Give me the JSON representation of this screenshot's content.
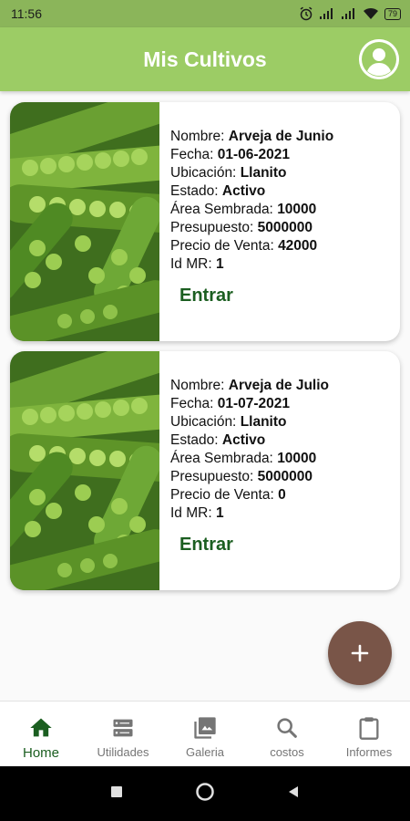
{
  "status": {
    "time": "11:56",
    "battery": "79"
  },
  "app": {
    "title": "Mis Cultivos"
  },
  "cards": [
    {
      "nombre_label": "Nombre: ",
      "nombre": "Arveja de Junio",
      "fecha_label": "Fecha: ",
      "fecha": "01-06-2021",
      "ubicacion_label": "Ubicación: ",
      "ubicacion": "Llanito",
      "estado_label": "Estado: ",
      "estado": "Activo",
      "area_label": "Área Sembrada: ",
      "area": "10000",
      "presupuesto_label": "Presupuesto: ",
      "presupuesto": "5000000",
      "precio_label": "Precio de Venta: ",
      "precio": "42000",
      "id_label": "Id MR: ",
      "id": "1",
      "button": "Entrar"
    },
    {
      "nombre_label": "Nombre: ",
      "nombre": "Arveja de Julio",
      "fecha_label": "Fecha: ",
      "fecha": "01-07-2021",
      "ubicacion_label": "Ubicación: ",
      "ubicacion": "Llanito",
      "estado_label": "Estado: ",
      "estado": "Activo",
      "area_label": "Área Sembrada: ",
      "area": "10000",
      "presupuesto_label": "Presupuesto: ",
      "presupuesto": "5000000",
      "precio_label": "Precio de Venta: ",
      "precio": "0",
      "id_label": "Id MR: ",
      "id": "1",
      "button": "Entrar"
    }
  ],
  "fab": {
    "icon": "plus-icon"
  },
  "nav": {
    "items": [
      {
        "label": "Home",
        "icon": "home-icon"
      },
      {
        "label": "Utilidades",
        "icon": "storage-icon"
      },
      {
        "label": "Galeria",
        "icon": "gallery-icon"
      },
      {
        "label": "costos",
        "icon": "search-icon"
      },
      {
        "label": "Informes",
        "icon": "clipboard-icon"
      }
    ]
  },
  "colors": {
    "app_bar": "#9ccc65",
    "status_bar": "#8bb55a",
    "active_nav": "#1b5e20",
    "fab": "#795548",
    "button_text": "#1b5e20"
  }
}
